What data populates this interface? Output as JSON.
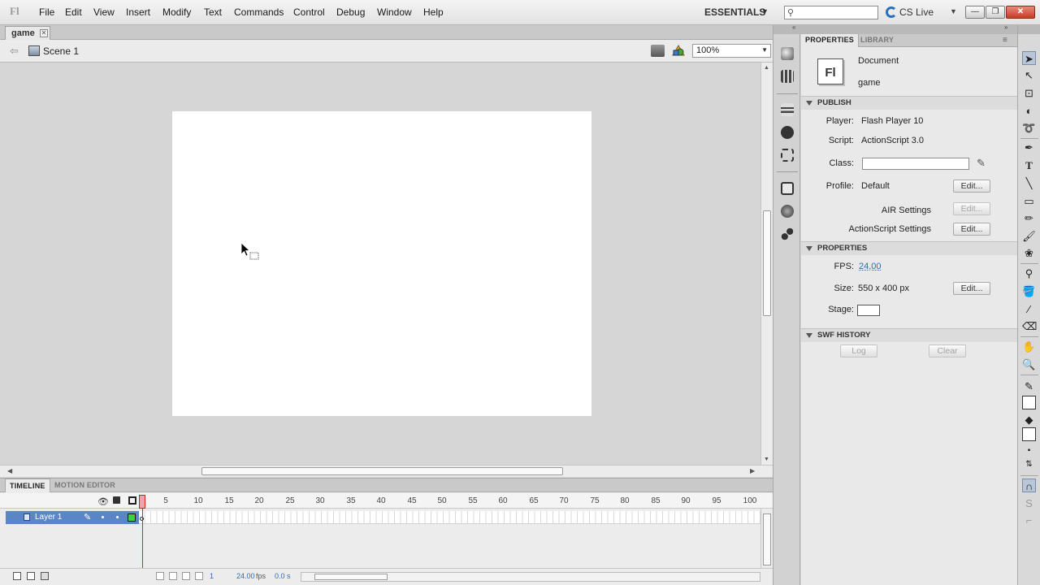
{
  "menubar": {
    "items": [
      "File",
      "Edit",
      "View",
      "Insert",
      "Modify",
      "Text",
      "Commands",
      "Control",
      "Debug",
      "Window",
      "Help"
    ],
    "workspace": "ESSENTIALS",
    "search_placeholder": "",
    "cs_live": "CS Live"
  },
  "document_tab": {
    "name": "game"
  },
  "editbar": {
    "scene": "Scene 1",
    "zoom": "100%"
  },
  "timeline": {
    "tabs": [
      "TIMELINE",
      "MOTION EDITOR"
    ],
    "frame_numbers": [
      "1",
      "5",
      "10",
      "15",
      "20",
      "25",
      "30",
      "35",
      "40",
      "45",
      "50",
      "55",
      "60",
      "65",
      "70",
      "75",
      "80",
      "85",
      "90",
      "95",
      "100"
    ],
    "layer_name": "Layer 1",
    "current_frame": "1",
    "fps": "24.00",
    "fps_unit": "fps",
    "elapsed": "0.0 s"
  },
  "properties": {
    "tabs": [
      "PROPERTIES",
      "LIBRARY"
    ],
    "doc_icon_label": "Fl",
    "doc_type": "Document",
    "doc_name": "game",
    "publish": {
      "title": "PUBLISH",
      "player_label": "Player:",
      "player_value": "Flash Player 10",
      "script_label": "Script:",
      "script_value": "ActionScript 3.0",
      "class_label": "Class:",
      "class_value": "",
      "profile_label": "Profile:",
      "profile_value": "Default",
      "edit_label": "Edit...",
      "air_settings": "AIR Settings",
      "as_settings": "ActionScript Settings"
    },
    "props_section": {
      "title": "PROPERTIES",
      "fps_label": "FPS:",
      "fps_value": "24,00",
      "size_label": "Size:",
      "size_value": "550 x 400 px",
      "stage_label": "Stage:",
      "stage_color": "#ffffff"
    },
    "swf_history": {
      "title": "SWF HISTORY",
      "log_label": "Log",
      "clear_label": "Clear"
    }
  },
  "colors": {
    "accent": "#2a6db5",
    "layer_selected": "#5b86c6",
    "layer_outline": "#3ed03e",
    "playhead": "#dd2222"
  }
}
